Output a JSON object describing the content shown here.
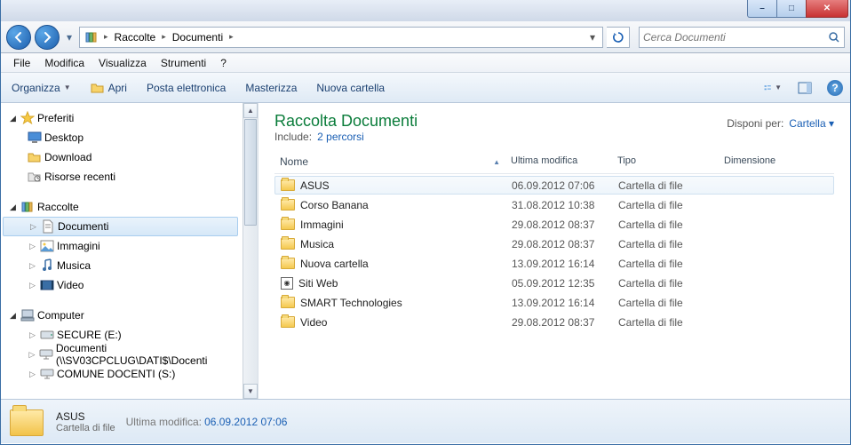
{
  "window": {
    "minimize": "–",
    "maximize": "□",
    "close": "✕"
  },
  "nav": {
    "back": "←",
    "forward": "→",
    "breadcrumb": [
      "Raccolte",
      "Documenti"
    ],
    "refresh": "↻"
  },
  "search": {
    "placeholder": "Cerca Documenti"
  },
  "menubar": [
    "File",
    "Modifica",
    "Visualizza",
    "Strumenti",
    "?"
  ],
  "toolbar": {
    "organize": "Organizza",
    "open": "Apri",
    "email": "Posta elettronica",
    "burn": "Masterizza",
    "newfolder": "Nuova cartella"
  },
  "sidebar": {
    "favorites": {
      "label": "Preferiti",
      "items": [
        "Desktop",
        "Download",
        "Risorse recenti"
      ]
    },
    "libraries": {
      "label": "Raccolte",
      "items": [
        "Documenti",
        "Immagini",
        "Musica",
        "Video"
      ],
      "selected": 0
    },
    "computer": {
      "label": "Computer",
      "items": [
        "SECURE (E:)",
        "Documenti (\\\\SV03CPCLUG\\DATI$\\Docenti",
        "COMUNE DOCENTI (S:)"
      ]
    }
  },
  "library": {
    "title": "Raccolta Documenti",
    "includes_label": "Include:",
    "includes_count": "2 percorsi",
    "arrange_label": "Disponi per:",
    "arrange_value": "Cartella"
  },
  "columns": {
    "name": "Nome",
    "modified": "Ultima modifica",
    "type": "Tipo",
    "size": "Dimensione"
  },
  "rows": [
    {
      "name": "ASUS",
      "modified": "06.09.2012 07:06",
      "type": "Cartella di file",
      "icon": "folder",
      "selected": true
    },
    {
      "name": "Corso Banana",
      "modified": "31.08.2012 10:38",
      "type": "Cartella di file",
      "icon": "folder"
    },
    {
      "name": "Immagini",
      "modified": "29.08.2012 08:37",
      "type": "Cartella di file",
      "icon": "folder"
    },
    {
      "name": "Musica",
      "modified": "29.08.2012 08:37",
      "type": "Cartella di file",
      "icon": "folder"
    },
    {
      "name": "Nuova cartella",
      "modified": "13.09.2012 16:14",
      "type": "Cartella di file",
      "icon": "folder"
    },
    {
      "name": "Siti Web",
      "modified": "05.09.2012 12:35",
      "type": "Cartella di file",
      "icon": "web"
    },
    {
      "name": "SMART Technologies",
      "modified": "13.09.2012 16:14",
      "type": "Cartella di file",
      "icon": "folder"
    },
    {
      "name": "Video",
      "modified": "29.08.2012 08:37",
      "type": "Cartella di file",
      "icon": "folder"
    }
  ],
  "details": {
    "name": "ASUS",
    "type": "Cartella di file",
    "mod_label": "Ultima modifica:",
    "mod_value": "06.09.2012 07:06"
  }
}
